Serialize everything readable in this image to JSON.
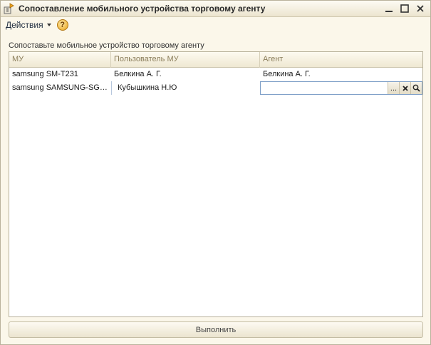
{
  "window": {
    "title": "Сопоставление мобильного устройства торговому агенту",
    "controls": {
      "close": "✕",
      "maximize": "☐",
      "minimize": "—"
    }
  },
  "toolbar": {
    "actions_label": "Действия",
    "help_label": "?"
  },
  "hint_text": "Сопоставьте мобильное устройство торговому агенту",
  "table": {
    "columns": [
      "МУ",
      "Пользователь МУ",
      "Агент"
    ],
    "rows": [
      {
        "device": "samsung SM-T231",
        "user": "Белкина А. Г.",
        "agent": "Белкина А. Г."
      },
      {
        "device": "samsung SAMSUNG-SGH-...",
        "user": "Кубышкина Н.Ю",
        "agent": ""
      }
    ]
  },
  "editor_buttons": {
    "choose": "...",
    "clear": "✕",
    "open": "search"
  },
  "execute_label": "Выполнить",
  "colors": {
    "accent": "#e7a21a",
    "border": "#b8b29b",
    "header_text": "#8a7d5a"
  }
}
